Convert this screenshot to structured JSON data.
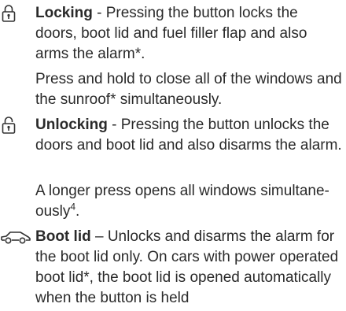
{
  "locking": {
    "title": "Locking",
    "dash": " - ",
    "desc": "Pressing the button locks the doors, boot lid and fuel filler flap and also arms the alarm*.",
    "extra": "Press and hold to close all of the windows and the sunroof* simultaneously."
  },
  "unlocking": {
    "title": "Unlocking",
    "dash": " - ",
    "desc": "Pressing the button unlocks the doors and boot lid and also disarms the alarm.",
    "extra": "A longer press opens all windows simultane-ously",
    "footnote": "4",
    "extra_end": "."
  },
  "boot": {
    "title": "Boot lid",
    "dash": " – ",
    "desc": "Unlocks and disarms the alarm for the boot lid only. On cars with power operated boot lid*, the boot lid is opened automatically when the button is held"
  },
  "icons": [
    "lock-closed-icon",
    "lock-open-icon",
    "car-boot-icon"
  ]
}
